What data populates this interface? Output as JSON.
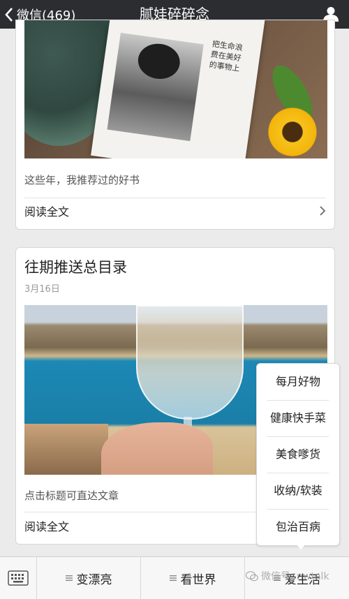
{
  "navbar": {
    "back_label": "微信(469)",
    "title": "腻娃碎碎念",
    "user_icon": "user-icon"
  },
  "card1": {
    "image_text": "把生命浪费在美好的事物上",
    "description": "这些年，我推荐过的好书",
    "read_label": "阅读全文"
  },
  "card2": {
    "title": "往期推送总目录",
    "date": "3月16日",
    "description": "点击标题可直达文章",
    "read_label": "阅读全文"
  },
  "popup": {
    "items": [
      "每月好物",
      "健康快手菜",
      "美食嗲货",
      "收纳/软装",
      "包治百病"
    ]
  },
  "bottom_menu": {
    "keyboard_icon": "keyboard-icon",
    "tabs": [
      "变漂亮",
      "看世界",
      "爱生活"
    ]
  },
  "watermark": "微信号: nwtalk"
}
